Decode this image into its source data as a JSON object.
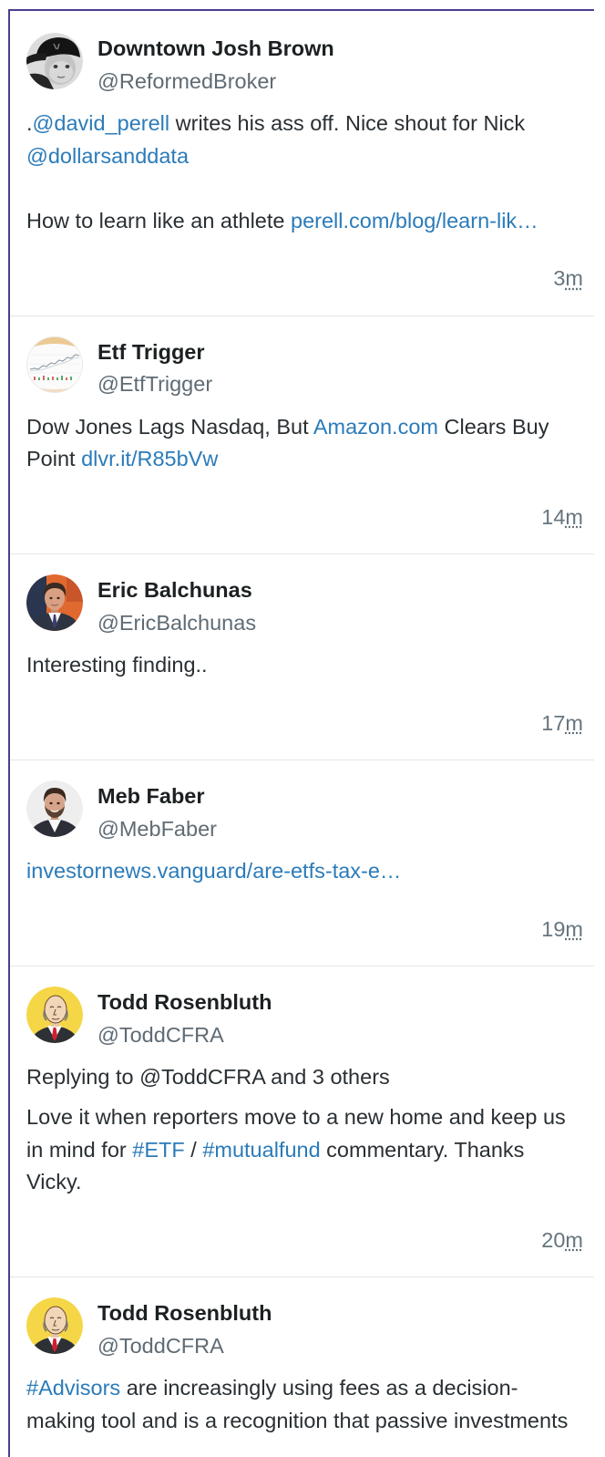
{
  "colors": {
    "frame_border": "#4e3d8f",
    "link": "#2b7bb9",
    "text": "#292f33",
    "secondary_text": "#66757f",
    "separator": "#e1e8ed"
  },
  "timeline": {
    "tweets": [
      {
        "name": "Downtown Josh Brown",
        "handle": "@ReformedBroker",
        "text_lines": [
          [
            ".",
            "@david_perell",
            " writes his ass off. Nice shout for Nick"
          ],
          [
            "@dollarsanddata"
          ],
          [
            "How to learn like an athlete ",
            "perell.com/blog/learn-lik…"
          ]
        ],
        "time_value": "3",
        "time_unit": "m"
      },
      {
        "name": "Etf Trigger",
        "handle": "@EtfTrigger",
        "text_lines": [
          [
            "Dow Jones Lags Nasdaq, But ",
            "Amazon.com",
            " Clears Buy"
          ],
          [
            "Point ",
            "dlvr.it/R85bVw"
          ]
        ],
        "time_value": "14",
        "time_unit": "m"
      },
      {
        "name": "Eric Balchunas",
        "handle": "@EricBalchunas",
        "text_lines": [
          [
            "Interesting finding.."
          ]
        ],
        "time_value": "17",
        "time_unit": "m"
      },
      {
        "name": "Meb Faber",
        "handle": "@MebFaber",
        "text_lines": [
          [
            "investornews.vanguard/are-etfs-tax-e…"
          ]
        ],
        "time_value": "19",
        "time_unit": "m"
      },
      {
        "name": "Todd Rosenbluth",
        "handle": "@ToddCFRA",
        "reply_context": "Replying to @ToddCFRA and 3 others",
        "text_lines": [
          [
            "Love it when reporters move to a new home and keep us"
          ],
          [
            "in mind for ",
            "#ETF",
            " / ",
            "#mutualfund",
            " commentary. Thanks"
          ],
          [
            "Vicky."
          ]
        ],
        "time_value": "20",
        "time_unit": "m"
      },
      {
        "name": "Todd Rosenbluth",
        "handle": "@ToddCFRA",
        "text_lines": [
          [
            "#Advisors",
            " are increasingly using fees as a decision-"
          ],
          [
            "making tool and is a recognition that passive investments"
          ]
        ]
      }
    ]
  }
}
